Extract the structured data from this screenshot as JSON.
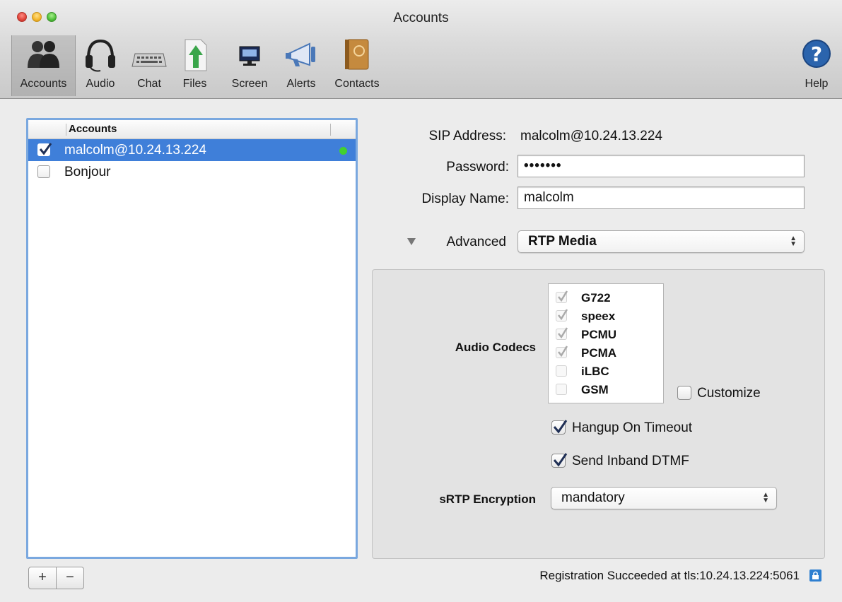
{
  "window": {
    "title": "Accounts"
  },
  "toolbar": {
    "items": [
      {
        "label": "Accounts",
        "icon": "accounts-icon",
        "selected": true
      },
      {
        "label": "Audio",
        "icon": "headset-icon"
      },
      {
        "label": "Chat",
        "icon": "keyboard-icon"
      },
      {
        "label": "Files",
        "icon": "file-transfer-icon"
      },
      {
        "label": "Screen",
        "icon": "monitor-icon"
      },
      {
        "label": "Alerts",
        "icon": "megaphone-icon"
      },
      {
        "label": "Contacts",
        "icon": "address-book-icon"
      }
    ],
    "help": {
      "label": "Help",
      "icon": "help-icon"
    }
  },
  "accounts": {
    "header": "Accounts",
    "rows": [
      {
        "name": "malcolm@10.24.13.224",
        "checked": true,
        "selected": true,
        "status_color": "#42d02f"
      },
      {
        "name": "Bonjour",
        "checked": false,
        "selected": false
      }
    ],
    "add_label": "+",
    "remove_label": "−"
  },
  "form": {
    "sip_label": "SIP Address:",
    "sip_value": "malcolm@10.24.13.224",
    "password_label": "Password:",
    "password_value": "•••••••",
    "display_name_label": "Display Name:",
    "display_name_value": "malcolm",
    "advanced_label": "Advanced",
    "advanced_select": "RTP Media"
  },
  "rtp": {
    "codecs_label": "Audio Codecs",
    "codecs": [
      {
        "name": "G722",
        "checked": true
      },
      {
        "name": "speex",
        "checked": true
      },
      {
        "name": "PCMU",
        "checked": true
      },
      {
        "name": "PCMA",
        "checked": true
      },
      {
        "name": "iLBC",
        "checked": false
      },
      {
        "name": "GSM",
        "checked": false
      }
    ],
    "customize_label": "Customize",
    "hangup_label": "Hangup On Timeout",
    "dtmf_label": "Send Inband DTMF",
    "srtp_label": "sRTP Encryption",
    "srtp_value": "mandatory"
  },
  "status": {
    "text": "Registration Succeeded at tls:10.24.13.224:5061"
  },
  "colors": {
    "selection": "#3f7fd9",
    "online": "#42d02f",
    "focus_ring": "#7aa8df"
  }
}
